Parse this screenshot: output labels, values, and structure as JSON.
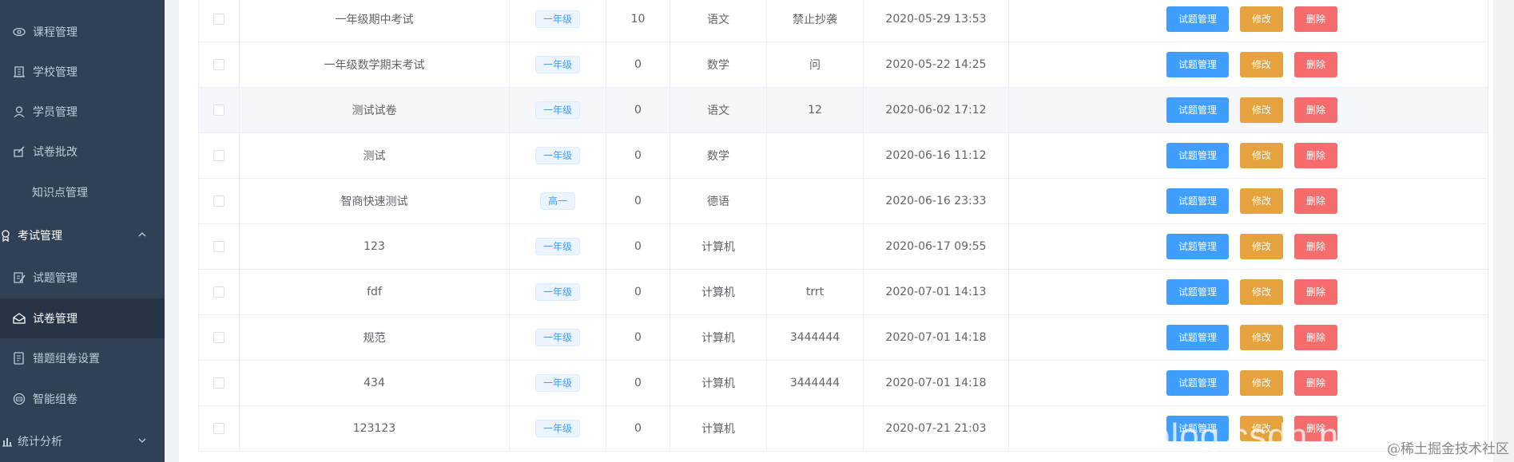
{
  "sidebar": {
    "items": [
      {
        "label": "课程管理",
        "icon": "eye-icon",
        "type": "sub"
      },
      {
        "label": "学校管理",
        "icon": "building-icon",
        "type": "sub"
      },
      {
        "label": "学员管理",
        "icon": "user-icon",
        "type": "sub"
      },
      {
        "label": "试卷批改",
        "icon": "edit-paper-icon",
        "type": "sub"
      },
      {
        "label": "知识点管理",
        "icon": "",
        "type": "sub"
      },
      {
        "label": "考试管理",
        "icon": "medal-icon",
        "type": "group"
      },
      {
        "label": "试题管理",
        "icon": "document-edit-icon",
        "type": "sub"
      },
      {
        "label": "试卷管理",
        "icon": "envelope-icon",
        "type": "sub",
        "active": true
      },
      {
        "label": "错题组卷设置",
        "icon": "list-icon",
        "type": "sub"
      },
      {
        "label": "智能组卷",
        "icon": "robot-icon",
        "type": "sub"
      },
      {
        "label": "统计分析",
        "icon": "bar-chart-icon",
        "type": "group"
      }
    ]
  },
  "table": {
    "rows": [
      {
        "name": "一年级期中考试",
        "grade": "一年级",
        "count": "10",
        "subject": "语文",
        "remark": "禁止抄袭",
        "time": "2020-05-29 13:53"
      },
      {
        "name": "一年级数学期末考试",
        "grade": "一年级",
        "count": "0",
        "subject": "数学",
        "remark": "问",
        "time": "2020-05-22 14:25"
      },
      {
        "name": "测试试卷",
        "grade": "一年级",
        "count": "0",
        "subject": "语文",
        "remark": "12",
        "time": "2020-06-02 17:12"
      },
      {
        "name": "测试",
        "grade": "一年级",
        "count": "0",
        "subject": "数学",
        "remark": "",
        "time": "2020-06-16 11:12"
      },
      {
        "name": "智商快速测试",
        "grade": "高一",
        "count": "0",
        "subject": "德语",
        "remark": "",
        "time": "2020-06-16 23:33"
      },
      {
        "name": "123",
        "grade": "一年级",
        "count": "0",
        "subject": "计算机",
        "remark": "",
        "time": "2020-06-17 09:55"
      },
      {
        "name": "fdf",
        "grade": "一年级",
        "count": "0",
        "subject": "计算机",
        "remark": "trrt",
        "time": "2020-07-01 14:13"
      },
      {
        "name": "规范",
        "grade": "一年级",
        "count": "0",
        "subject": "计算机",
        "remark": "3444444",
        "time": "2020-07-01 14:18"
      },
      {
        "name": "434",
        "grade": "一年级",
        "count": "0",
        "subject": "计算机",
        "remark": "3444444",
        "time": "2020-07-01 14:18"
      },
      {
        "name": "123123",
        "grade": "一年级",
        "count": "0",
        "subject": "计算机",
        "remark": "",
        "time": "2020-07-21 21:03"
      }
    ],
    "actions": {
      "manage": "试题管理",
      "edit": "修改",
      "delete": "删除"
    }
  },
  "watermark": {
    "text": "@稀土掘金技术社区",
    "background_text": "blog.csdn.ne"
  },
  "colors": {
    "sidebar_bg": "#304156",
    "primary": "#409eff",
    "warning": "#e6a23c",
    "danger": "#f56c6c"
  }
}
